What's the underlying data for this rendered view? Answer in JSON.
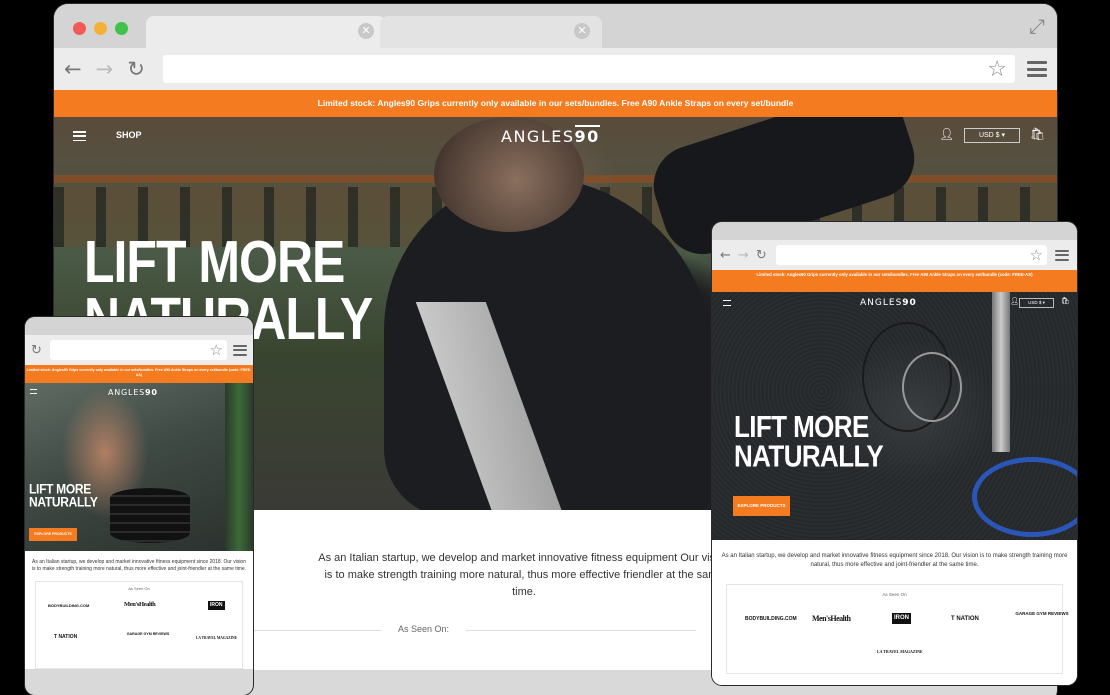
{
  "promo_banner": "Limited stock: Angles90 Grips currently only available in our sets/bundles. Free A90 Ankle Straps on every set/bundle (code: FREE-AS)",
  "promo_banner_desktop": "Limited stock: Angles90 Grips currently only available in our sets/bundles. Free A90 Ankle Straps on every set/bundle",
  "header": {
    "shop": "SHOP",
    "logo_text": "ANGLES",
    "logo_num": "90",
    "currency": "USD $"
  },
  "hero": {
    "title": "LIFT MORE\nNATURALLY",
    "cta": "EXPLORE PRODUCTS"
  },
  "about": {
    "text": "As an Italian startup, we develop and market innovative fitness equipment since 2018. Our vision is to make strength training more natural, thus more effective and joint-friendler at the same time.",
    "desktop_text": "As an Italian startup, we develop and market innovative fitness equipment Our vision is to make strength training more natural, thus more effective friendler at the same time."
  },
  "as_seen_on": {
    "label": "As Seen On",
    "label_desktop": "As Seen On:",
    "logos": [
      "BODYBUILDING.COM",
      "Men'sHealth",
      "IRON",
      "T NATION",
      "GARAGE GYM REVIEWS",
      "LA TRAVEL MAGAZINE"
    ]
  },
  "icons": {
    "back": "back-arrow-icon",
    "forward": "forward-arrow-icon",
    "reload": "reload-icon",
    "bookmark": "star-icon",
    "menu": "hamburger-menu-icon",
    "user": "user-icon",
    "bag": "shopping-bag-icon"
  },
  "colors": {
    "accent": "#f47b20",
    "chrome": "#d9d9d9",
    "background": "#000000"
  }
}
